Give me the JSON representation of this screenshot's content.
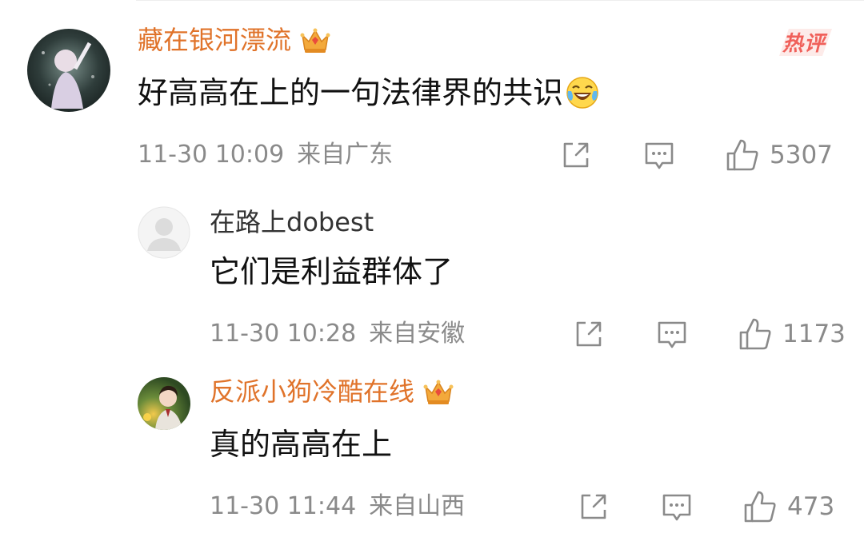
{
  "badge": {
    "hot": "热评"
  },
  "comments": [
    {
      "username": "藏在银河漂流",
      "vip": true,
      "text": "好高高在上的一句法律界的共识",
      "emoji": "laugh-cry-icon",
      "time": "11-30 10:09",
      "location": "来自广东",
      "likes": "5307"
    },
    {
      "username": "在路上dobest",
      "vip": false,
      "text": "它们是利益群体了",
      "time": "11-30 10:28",
      "location": "来自安徽",
      "likes": "1173"
    },
    {
      "username": "反派小狗冷酷在线",
      "vip": true,
      "text": "真的高高在上",
      "time": "11-30 11:44",
      "location": "来自山西",
      "likes": "473"
    }
  ],
  "colors": {
    "vip_name": "#e0732a",
    "plain_name": "#333333",
    "meta": "#8a8a8a",
    "hot_badge": "#f0605a"
  }
}
